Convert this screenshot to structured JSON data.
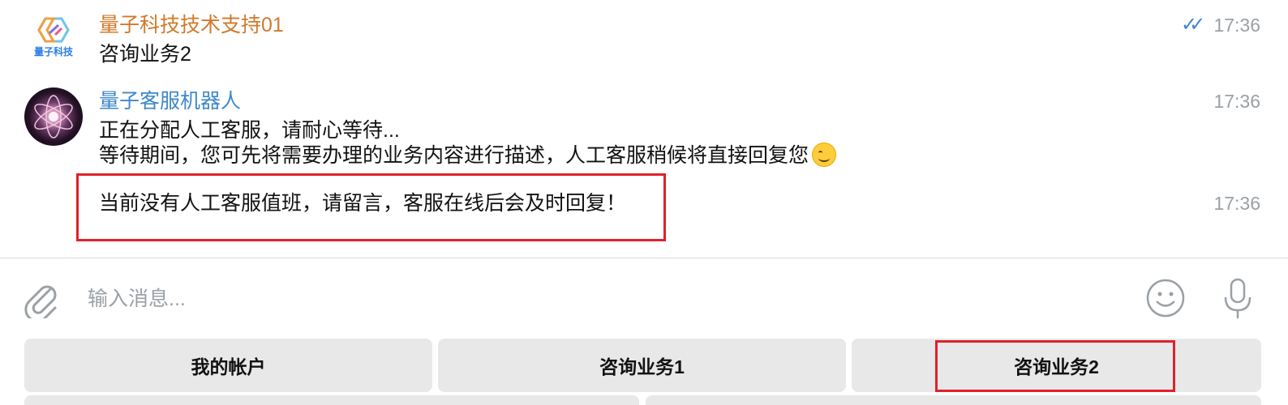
{
  "messages": [
    {
      "sender": "量子科技技术支持01",
      "text": "咨询业务2",
      "time": "17:36",
      "status": "read",
      "avatar": "量子科技"
    },
    {
      "sender": "量子客服机器人",
      "lines": [
        "正在分配人工客服，请耐心等待...",
        "等待期间，您可先将需要办理的业务内容进行描述，人工客服稍候将直接回复您"
      ],
      "emoji": "smiling-face",
      "time": "17:36"
    },
    {
      "text": "当前没有人工客服值班，请留言，客服在线后会及时回复！",
      "time": "17:36"
    }
  ],
  "input": {
    "placeholder": "输入消息..."
  },
  "keyboard": {
    "buttons": [
      "我的帐户",
      "咨询业务1",
      "咨询业务2"
    ]
  },
  "colors": {
    "sender_orange": "#d07a2b",
    "sender_blue": "#3e88c8",
    "highlight_red": "#e0212a",
    "check_blue": "#3f83d4"
  }
}
